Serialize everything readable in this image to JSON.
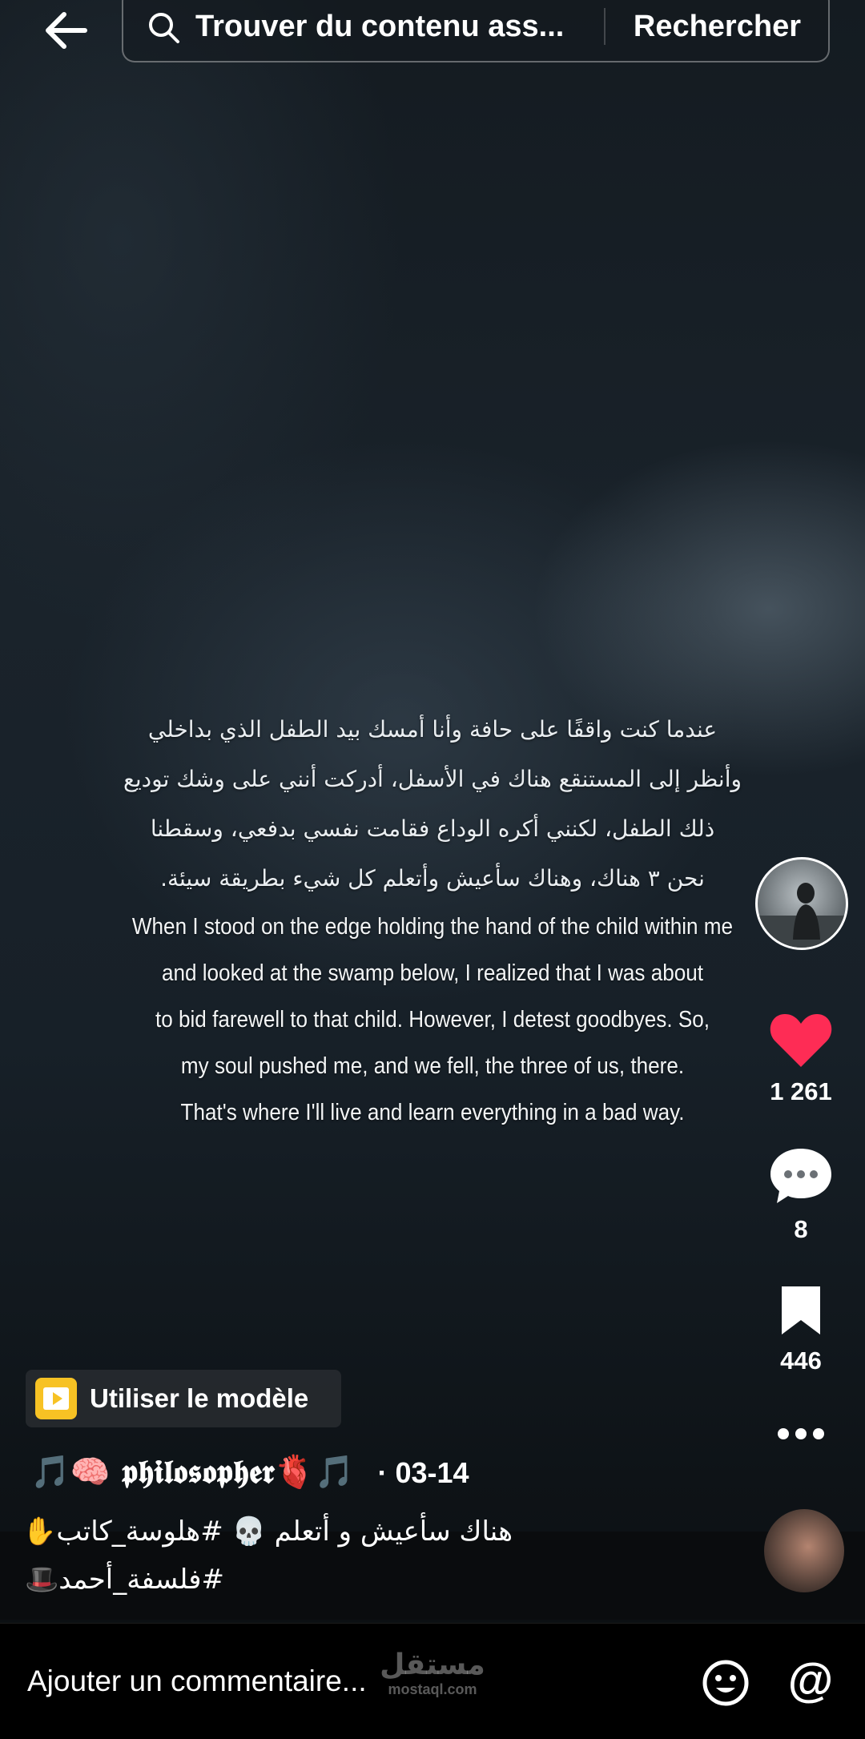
{
  "search": {
    "placeholder_text": "Trouver du contenu ass...",
    "button_label": "Rechercher"
  },
  "video_text": {
    "arabic_lines": [
      "عندما كنت واقفًا على حافة وأنا أمسك بيد الطفل الذي بداخلي",
      "وأنظر إلى المستنقع هناك في الأسفل، أدركت أنني على وشك توديع",
      "ذلك الطفل، لكنني أكره الوداع فقامت نفسي بدفعي، وسقطنا",
      "نحن ٣ هناك، وهناك سأعيش وأتعلم كل شيء بطريقة سيئة."
    ],
    "english_lines": [
      "When I stood on the edge holding the hand of the child within me",
      "and looked at the swamp below, I realized that I was about",
      "to bid farewell to that child. However, I detest goodbyes. So,",
      "my soul pushed me, and we fell, the three of us, there.",
      "That's where I'll live and learn everything in a bad way."
    ]
  },
  "actions": {
    "likes": "1 261",
    "comments": "8",
    "saves": "446"
  },
  "template_button": {
    "label": "Utiliser le modèle"
  },
  "author": {
    "name": "🎵🧠 𝖕𝖍𝖎𝖑𝖔𝖘𝖔𝖕𝖍𝖊𝖗🫀🎵",
    "date": "· 03-14"
  },
  "description": {
    "line1": "هناك سأعيش و أتعلم 💀 #هلوسة_كاتب✋",
    "line2": "#فلسفة_أحمد🎩"
  },
  "comment_bar": {
    "placeholder": "Ajouter un commentaire..."
  },
  "watermark": {
    "arabic": "مستقل",
    "latin": "mostaql.com"
  },
  "colors": {
    "like": "#fe2c55",
    "template_icon": "#f7c224"
  }
}
